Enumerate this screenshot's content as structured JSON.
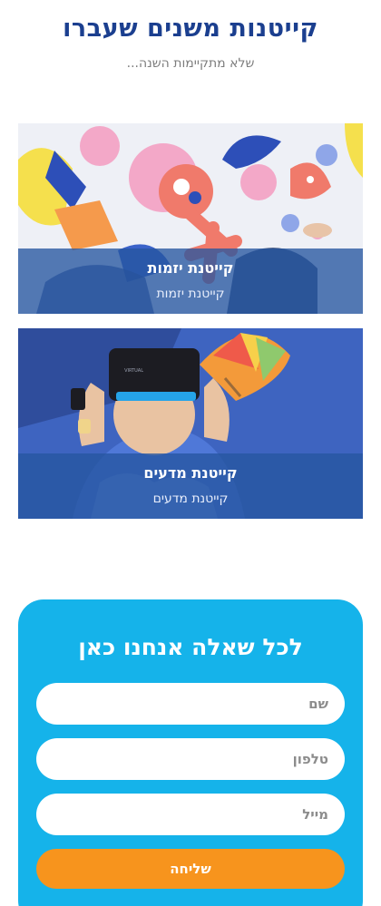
{
  "section": {
    "title": "קייטנות משנים שעברו",
    "subtitle": "שלא מתקיימות השנה..."
  },
  "cards": [
    {
      "title": "קייטנת יזמות",
      "subtitle": "קייטנת יזמות"
    },
    {
      "title": "קייטנת מדעים",
      "subtitle": "קייטנת מדעים"
    }
  ],
  "contact": {
    "title": "לכל שאלה אנחנו כאן",
    "name_placeholder": "שם",
    "phone_placeholder": "טלפון",
    "email_placeholder": "מייל",
    "submit_label": "שליחה"
  },
  "colors": {
    "heading": "#1b3f8f",
    "overlay": "#2656a0",
    "contact_bg": "#15b3ea",
    "button": "#f7941d"
  }
}
